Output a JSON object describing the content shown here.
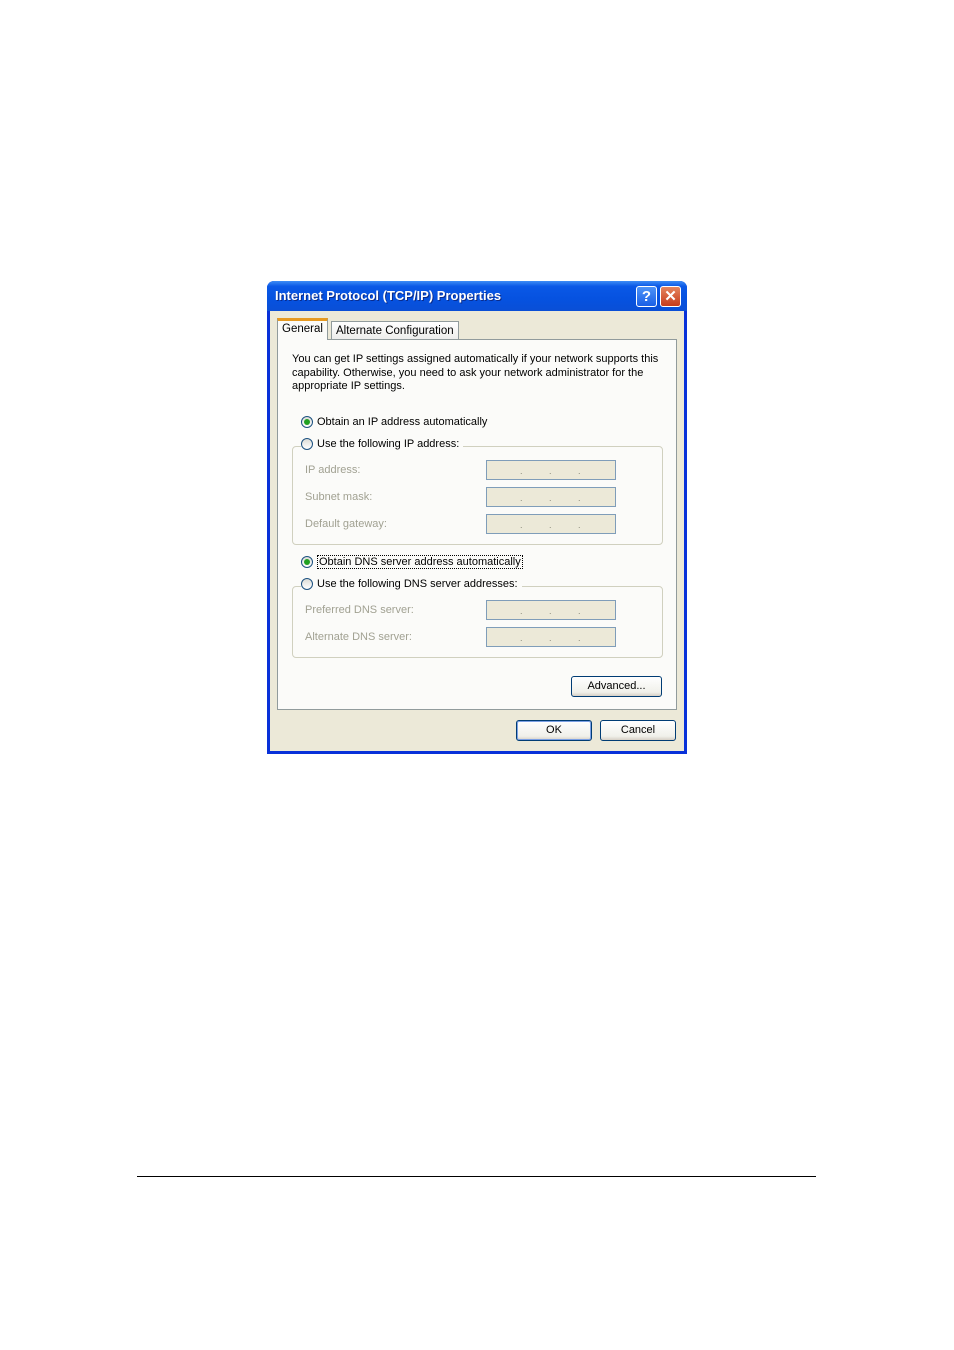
{
  "dialog": {
    "title": "Internet Protocol (TCP/IP) Properties",
    "help_glyph": "?",
    "close_glyph": "✕"
  },
  "tabs": [
    {
      "label": "General",
      "active": true
    },
    {
      "label": "Alternate Configuration",
      "active": false
    }
  ],
  "info_text": "You can get IP settings assigned automatically if your network supports this capability. Otherwise, you need to ask your network administrator for the appropriate IP settings.",
  "ip_section": {
    "auto_label": "Obtain an IP address automatically",
    "manual_label": "Use the following IP address:",
    "selected": "auto",
    "fields": [
      {
        "label": "IP address:",
        "value": ". . ."
      },
      {
        "label": "Subnet mask:",
        "value": ". . ."
      },
      {
        "label": "Default gateway:",
        "value": ". . ."
      }
    ]
  },
  "dns_section": {
    "auto_label": "Obtain DNS server address automatically",
    "manual_label": "Use the following DNS server addresses:",
    "selected": "auto",
    "fields": [
      {
        "label": "Preferred DNS server:",
        "value": ". . ."
      },
      {
        "label": "Alternate DNS server:",
        "value": ". . ."
      }
    ]
  },
  "buttons": {
    "advanced": "Advanced...",
    "ok": "OK",
    "cancel": "Cancel"
  },
  "colors": {
    "title_bar": "#0a58e6",
    "radio_selected": "#21a121",
    "close_button": "#c73b1a"
  }
}
